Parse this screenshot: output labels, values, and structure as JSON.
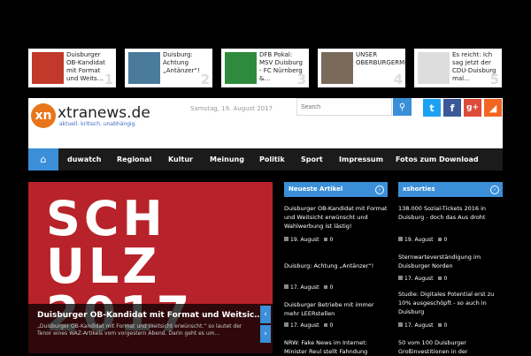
{
  "ticker": [
    {
      "text": "Duisburger OB-Kandidat mit Format und Weits…",
      "num": "1",
      "thumb_color": "#c0392b"
    },
    {
      "text": "Duisburg: Achtung „Antänzer“!",
      "num": "2",
      "thumb_color": "#4a7a9c"
    },
    {
      "text": "DFB Pokal: MSV Duisburg - FC Nürnberg &…",
      "num": "3",
      "thumb_color": "#2e8b3e"
    },
    {
      "text": "UNSER OBERBURGERMEISTE…",
      "num": "4",
      "thumb_color": "#7a6a5a"
    },
    {
      "text": "Es reicht: Ich sag jetzt der CDU-Duisburg mal…",
      "num": "5",
      "thumb_color": "#dddddd"
    }
  ],
  "header": {
    "logo_mark": "xn",
    "logo_name": "xtranews.de",
    "logo_tagline": "aktuell. kritisch. unabhängig.",
    "date": "Samstag, 19. August 2017",
    "search_placeholder": "Search",
    "search_icon": "search-icon",
    "social": [
      {
        "name": "twitter",
        "glyph": "t",
        "color": "#1da1f2"
      },
      {
        "name": "facebook",
        "glyph": "f",
        "color": "#3b5998"
      },
      {
        "name": "googleplus",
        "glyph": "g+",
        "color": "#dd4b39"
      },
      {
        "name": "rss",
        "glyph": "◢",
        "color": "#f26522"
      }
    ]
  },
  "nav": {
    "home_icon": "home-icon",
    "items": [
      "duwatch",
      "Regional",
      "Kultur",
      "Meinung",
      "Politik",
      "Sport",
      "Impressum",
      "Fotos zum Download"
    ]
  },
  "slider": {
    "big_text_1": "SCH",
    "big_text_2": "ULZ",
    "big_text_3": "2017",
    "title": "Duisburger OB-Kandidat mit Format und Weitsic…",
    "excerpt": "„Duisburger OB-Kandidat mit Format und Weitsicht erwünscht.“ so lautet der Tenor eines WAZ-Artikels vom vorgestern Abend. Darin geht es um…",
    "prev": "‹",
    "next": "›"
  },
  "neueste": {
    "title": "Neueste Artikel",
    "articles": [
      {
        "title": "Duisburger OB-Kandidat mit Format und Weitsicht erwünscht und Wahlwerbung ist lästig!",
        "date": "19. August",
        "count": "0"
      },
      {
        "title": "Duisburg: Achtung „Antänzer“!",
        "date": "17. August",
        "count": "0"
      },
      {
        "title": "Duisburger Betriebe mit immer mehr LEERstellen",
        "date": "17. August",
        "count": "0"
      },
      {
        "title": "NRW: Fake News im Internet: Minister Reul stellt Fahndung",
        "date": "",
        "count": ""
      }
    ]
  },
  "xshorties": {
    "title": "xshorties",
    "articles": [
      {
        "title": "138.000 Sozial-Tickets 2016 in Duisburg - doch das Aus droht",
        "date": "19. August",
        "count": "0"
      },
      {
        "title": "Sternwarteverständigung im Duisburger Norden",
        "date": "17. August",
        "count": "0"
      },
      {
        "title": "Studie: Digitales Potential erst zu 10% ausgeschöpft - so auch in Duisburg",
        "date": "17. August",
        "count": "0"
      },
      {
        "title": "50 vom 100 Duisburger Großinvestitionen in der",
        "date": "",
        "count": ""
      }
    ]
  }
}
